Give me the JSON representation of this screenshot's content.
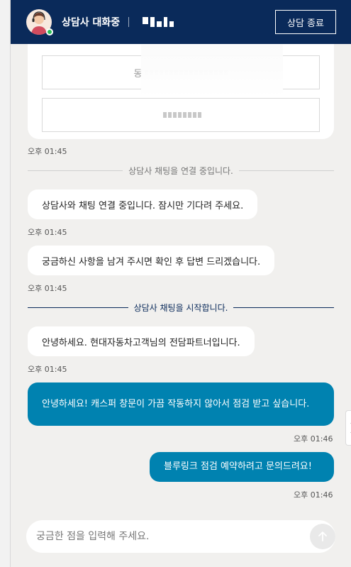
{
  "header": {
    "title": "상담사 대화중",
    "end_button": "상담 종료",
    "status": "online"
  },
  "card": {
    "option1_prefix": "동",
    "option2_prefix": ""
  },
  "messages": {
    "time_card": "오후 01:45",
    "sys_connecting": "상담사 채팅을 연결 중입니다.",
    "msg1": "상담사와 채팅 연결 중입니다. 잠시만 기다려 주세요.",
    "time1": "오후 01:45",
    "msg2": "궁금하신 사항을 남겨 주시면 확인 후 답변 드리겠습니다.",
    "time2": "오후 01:45",
    "sys_started": "상담사 채팅을 시작합니다.",
    "msg3": "안녕하세요.  현대자동차고객님의 전담파트너입니다.",
    "time3": "오후 01:45",
    "user1": "안녕하세요! 캐스퍼 창문이 가끔 작동하지 않아서 점검 받고 싶습니다.",
    "time4": "오후 01:46",
    "user2": "블루링크 점검 예약하려고 문의드려요!",
    "time5": "오후 01:46"
  },
  "input": {
    "placeholder": "궁금한 점을 입력해 주세요."
  },
  "colors": {
    "header_bg": "#0a2a5a",
    "user_bubble": "#0082b0",
    "online": "#2bbf56"
  },
  "icons": {
    "avatar": "agent-headset-avatar",
    "side_tab": "collapse-arrow-icon",
    "send": "arrow-up-icon"
  }
}
